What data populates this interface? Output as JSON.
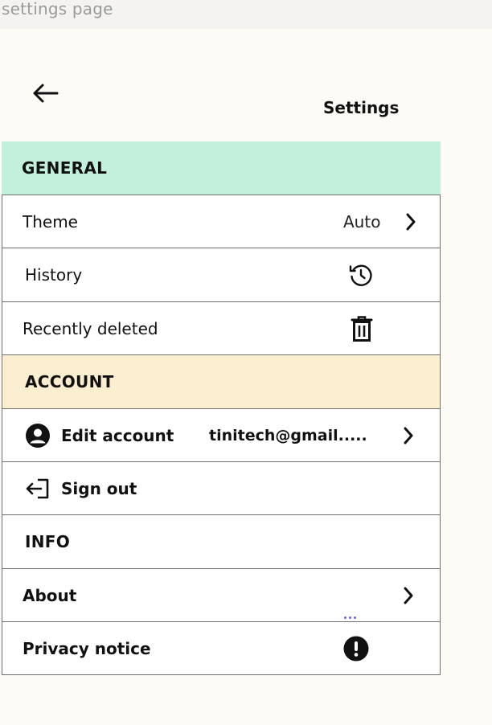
{
  "window": {
    "caption": "settings page"
  },
  "header": {
    "title": "Settings",
    "back_icon": "arrow-left-icon"
  },
  "sections": {
    "general": {
      "title": "GENERAL",
      "color": "#c3f0db",
      "items": {
        "theme": {
          "label": "Theme",
          "value": "Auto",
          "icon": "chevron-right-icon"
        },
        "history": {
          "label": "History",
          "icon": "history-icon"
        },
        "recently_deleted": {
          "label": "Recently deleted",
          "icon": "trash-icon"
        }
      }
    },
    "account": {
      "title": "ACCOUNT",
      "color": "#fbefcf",
      "items": {
        "edit_account": {
          "label": "Edit account",
          "value": "tinitech@gmail.....",
          "icon": "user-circle-icon"
        },
        "sign_out": {
          "label": "Sign out",
          "icon": "sign-out-icon"
        }
      }
    },
    "info": {
      "title": "INFO",
      "items": {
        "about": {
          "label": "About",
          "icon": "chevron-right-icon"
        },
        "privacy_notice": {
          "label": "Privacy notice",
          "icon": "alert-circle-icon"
        }
      }
    }
  }
}
